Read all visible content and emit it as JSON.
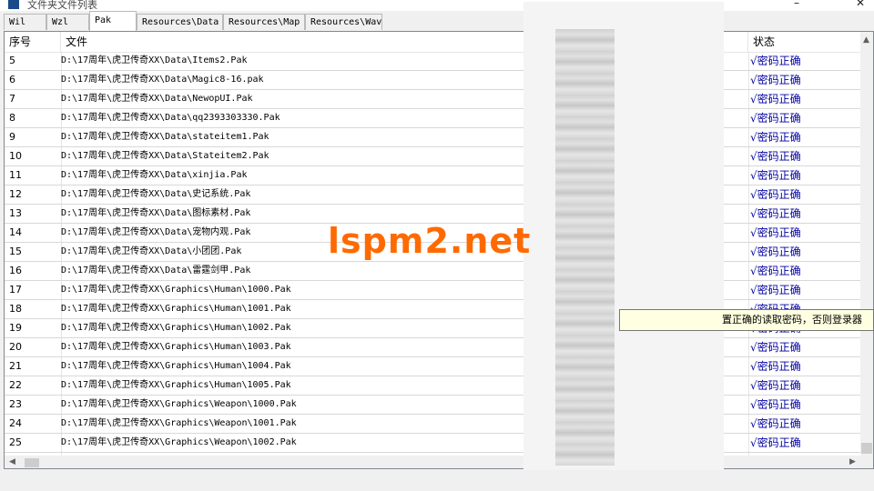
{
  "window": {
    "title": "文件夹文件列表"
  },
  "tabs": [
    {
      "label": "Wil"
    },
    {
      "label": "Wzl"
    },
    {
      "label": "Pak"
    },
    {
      "label": "Resources\\Data"
    },
    {
      "label": "Resources\\Map"
    },
    {
      "label": "Resources\\Wav"
    }
  ],
  "active_tab": "Pak",
  "columns": {
    "index": "序号",
    "file": "文件",
    "status": "状态"
  },
  "rows": [
    {
      "index": "5",
      "file": "D:\\17周年\\虎卫传奇XX\\Data\\Items2.Pak",
      "status": "√密码正确"
    },
    {
      "index": "6",
      "file": "D:\\17周年\\虎卫传奇XX\\Data\\Magic8-16.pak",
      "status": "√密码正确"
    },
    {
      "index": "7",
      "file": "D:\\17周年\\虎卫传奇XX\\Data\\NewopUI.Pak",
      "status": "√密码正确"
    },
    {
      "index": "8",
      "file": "D:\\17周年\\虎卫传奇XX\\Data\\qq2393303330.Pak",
      "status": "√密码正确"
    },
    {
      "index": "9",
      "file": "D:\\17周年\\虎卫传奇XX\\Data\\stateitem1.Pak",
      "status": "√密码正确"
    },
    {
      "index": "10",
      "file": "D:\\17周年\\虎卫传奇XX\\Data\\Stateitem2.Pak",
      "status": "√密码正确"
    },
    {
      "index": "11",
      "file": "D:\\17周年\\虎卫传奇XX\\Data\\xinjia.Pak",
      "status": "√密码正确"
    },
    {
      "index": "12",
      "file": "D:\\17周年\\虎卫传奇XX\\Data\\史记系统.Pak",
      "status": "√密码正确"
    },
    {
      "index": "13",
      "file": "D:\\17周年\\虎卫传奇XX\\Data\\图标素材.Pak",
      "status": "√密码正确"
    },
    {
      "index": "14",
      "file": "D:\\17周年\\虎卫传奇XX\\Data\\宠物内观.Pak",
      "status": "√密码正确"
    },
    {
      "index": "15",
      "file": "D:\\17周年\\虎卫传奇XX\\Data\\小团团.Pak",
      "status": "√密码正确"
    },
    {
      "index": "16",
      "file": "D:\\17周年\\虎卫传奇XX\\Data\\雷霆剑甲.Pak",
      "status": "√密码正确"
    },
    {
      "index": "17",
      "file": "D:\\17周年\\虎卫传奇XX\\Graphics\\Human\\1000.Pak",
      "status": "√密码正确"
    },
    {
      "index": "18",
      "file": "D:\\17周年\\虎卫传奇XX\\Graphics\\Human\\1001.Pak",
      "status": "√密码正确"
    },
    {
      "index": "19",
      "file": "D:\\17周年\\虎卫传奇XX\\Graphics\\Human\\1002.Pak",
      "status": "√密码正确"
    },
    {
      "index": "20",
      "file": "D:\\17周年\\虎卫传奇XX\\Graphics\\Human\\1003.Pak",
      "status": "√密码正确"
    },
    {
      "index": "21",
      "file": "D:\\17周年\\虎卫传奇XX\\Graphics\\Human\\1004.Pak",
      "status": "√密码正确"
    },
    {
      "index": "22",
      "file": "D:\\17周年\\虎卫传奇XX\\Graphics\\Human\\1005.Pak",
      "status": "√密码正确"
    },
    {
      "index": "23",
      "file": "D:\\17周年\\虎卫传奇XX\\Graphics\\Weapon\\1000.Pak",
      "status": "√密码正确"
    },
    {
      "index": "24",
      "file": "D:\\17周年\\虎卫传奇XX\\Graphics\\Weapon\\1001.Pak",
      "status": "√密码正确"
    },
    {
      "index": "25",
      "file": "D:\\17周年\\虎卫传奇XX\\Graphics\\Weapon\\1002.Pak",
      "status": "√密码正确"
    }
  ],
  "tooltip": "置正确的读取密码，否则登录器",
  "watermark": "lspm2.net",
  "icons": {
    "close": "close-icon",
    "scroll_up": "chevron-up-icon",
    "scroll_left": "chevron-left-icon",
    "scroll_right": "chevron-right-icon"
  },
  "colors": {
    "status_text": "#0000a0",
    "watermark": "#ff6a00",
    "tooltip_bg": "#ffffe1"
  }
}
